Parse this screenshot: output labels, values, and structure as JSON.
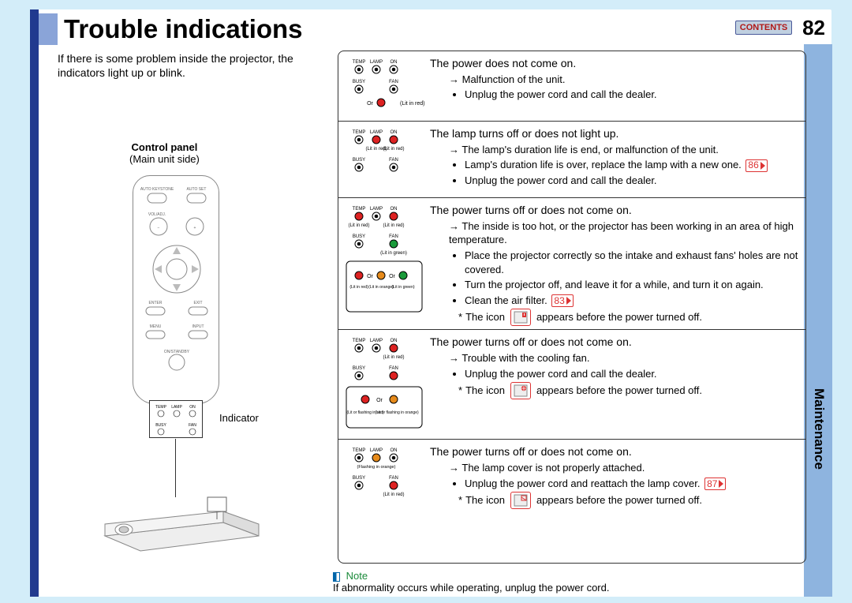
{
  "page": {
    "title": "Trouble indications",
    "number": "82",
    "contents_label": "CONTENTS",
    "side_tab": "Maintenance",
    "intro": "If there is some problem inside the projector, the indicators light up or blink."
  },
  "control_panel": {
    "title": "Control panel",
    "subtitle": "(Main unit side)",
    "indicator_label": "Indicator",
    "leds": {
      "temp": "TEMP",
      "lamp": "LAMP",
      "on": "ON",
      "busy": "BUSY",
      "fan": "FAN"
    },
    "remote_buttons": {
      "auto_keystone": "AUTO KEYSTONE",
      "auto_set": "AUTO SET",
      "vol_adj": "VOL/ADJ.",
      "enter": "ENTER",
      "exit": "EXIT",
      "menu": "MENU",
      "input": "INPUT",
      "on_standby": "ON/STANDBY"
    }
  },
  "indicator_labels": {
    "or": "Or",
    "lit_in_red": "(Lit in red)",
    "lit_in_green": "(Lit in green)",
    "lit_in_orange": "(Lit in orange)",
    "flashing_in_orange": "(Flashing in orange)",
    "lit_or_flashing_in_red": "(Lit or flashing in red)",
    "lit_or_flashing_in_orange": "(Lit or flashing in orange)"
  },
  "troubles": [
    {
      "title": "The power does not come on.",
      "cause": "Malfunction of the unit.",
      "actions": [
        "Unplug the power cord and call the dealer."
      ],
      "page_link": null,
      "icon_note": null
    },
    {
      "title": "The lamp turns off or does not light up.",
      "cause": "The lamp's duration life is end, or malfunction of the unit.",
      "actions": [
        "Lamp's duration life is over, replace the lamp with a new one.",
        "Unplug the power cord and call the dealer."
      ],
      "page_link": "86",
      "icon_note": null
    },
    {
      "title": "The power turns off or does not come on.",
      "cause": "The inside is too hot, or the projector has been working in an area of high temperature.",
      "actions": [
        "Place the projector correctly so the intake and exhaust fans' holes are not covered.",
        "Turn the projector off, and leave it for a while, and turn it on again.",
        "Clean the air filter."
      ],
      "page_link": "83",
      "icon_note": "appears before the power turned off.",
      "icon": "temp"
    },
    {
      "title": "The power turns off or does not come on.",
      "cause": "Trouble with the cooling fan.",
      "actions": [
        "Unplug the power cord and call the dealer."
      ],
      "page_link": null,
      "icon_note": "appears before the power turned off.",
      "icon": "fan"
    },
    {
      "title": "The power turns off or does not come on.",
      "cause": "The lamp cover is not properly attached.",
      "actions": [
        "Unplug the power cord and reattach the lamp cover."
      ],
      "page_link": "87",
      "icon_note": "appears before the power turned off.",
      "icon": "cover"
    }
  ],
  "note": {
    "label": "Note",
    "text": "If abnormality occurs while operating, unplug the power cord."
  },
  "icon_text": {
    "the_icon": "The icon"
  }
}
